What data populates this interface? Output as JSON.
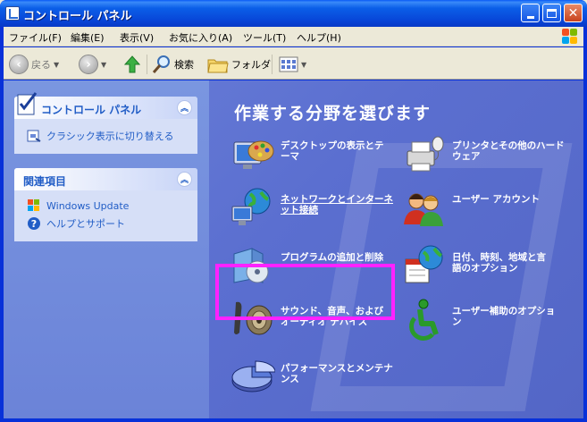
{
  "window": {
    "title": "コントロール パネル"
  },
  "menu": {
    "items": [
      "ファイル(F)",
      "編集(E)",
      "表示(V)",
      "お気に入り(A)",
      "ツール(T)",
      "ヘルプ(H)"
    ]
  },
  "toolbar": {
    "back_label": "戻る",
    "search_label": "検索",
    "folders_label": "フォルダ"
  },
  "sidebar": {
    "control_panel": {
      "title": "コントロール パネル",
      "link": "クラシック表示に切り替える"
    },
    "related": {
      "title": "関連項目",
      "links": [
        "Windows Update",
        "ヘルプとサポート"
      ]
    }
  },
  "main": {
    "heading": "作業する分野を選びます",
    "categories": [
      {
        "lines": [
          "デスクトップの表示とテ",
          "ーマ"
        ],
        "icon": "desktop-appearance-icon"
      },
      {
        "lines": [
          "プリンタとその他のハード",
          "ウェア"
        ],
        "icon": "printer-icon"
      },
      {
        "lines": [
          "ネットワークとインターネ",
          "ット接続"
        ],
        "icon": "network-globe-icon"
      },
      {
        "lines": [
          "ユーザー アカウント"
        ],
        "icon": "user-accounts-icon"
      },
      {
        "lines": [
          "プログラムの追加と削除"
        ],
        "icon": "add-remove-programs-icon"
      },
      {
        "lines": [
          "日付、時刻、地域と言",
          "語のオプション"
        ],
        "icon": "date-time-globe-icon"
      },
      {
        "lines": [
          "サウンド、音声、および",
          "オーディオ デバイス"
        ],
        "icon": "speaker-icon"
      },
      {
        "lines": [
          "ユーザー補助のオプショ",
          "ン"
        ],
        "icon": "accessibility-icon"
      },
      {
        "lines": [
          "パフォーマンスとメンテナ",
          "ンス"
        ],
        "icon": "performance-pie-icon"
      }
    ]
  },
  "colors": {
    "title_bar": "#0846d8",
    "content_bg": "#5b6fd0",
    "highlight": "#ff22ff",
    "link": "#215dc6"
  }
}
